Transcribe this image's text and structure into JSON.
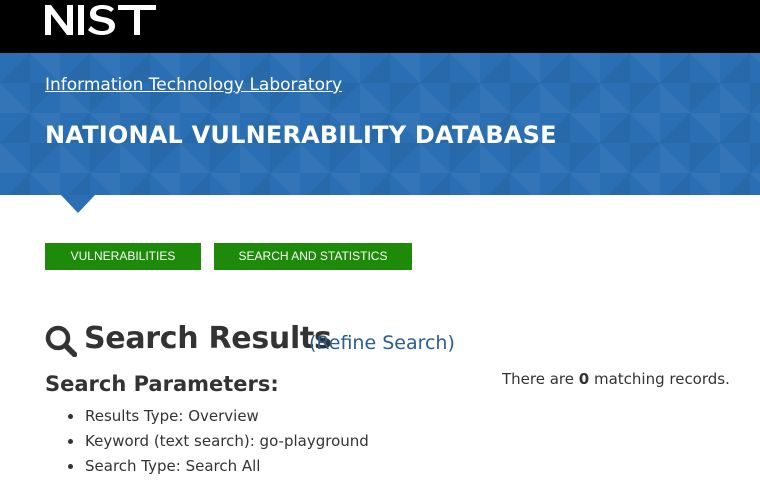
{
  "header": {
    "logo_text": "NIST",
    "lab_link": "Information Technology Laboratory",
    "site_title": "NATIONAL VULNERABILITY DATABASE"
  },
  "nav": {
    "buttons": [
      {
        "label": "VULNERABILITIES"
      },
      {
        "label": "SEARCH AND STATISTICS"
      }
    ]
  },
  "results": {
    "title": "Search Results",
    "refine_open": "(",
    "refine_label": "Refine Search",
    "refine_close": ")",
    "params_heading": "Search Parameters:",
    "params": [
      "Results Type: Overview",
      "Keyword (text search): go-playground",
      "Search Type: Search All"
    ],
    "count_prefix": "There are ",
    "count": "0",
    "count_suffix": " matching records."
  },
  "colors": {
    "top_bar": "#000000",
    "banner": "#2a6fb3",
    "nav_button": "#1d8a0a",
    "link": "#2a5d94",
    "text": "#333333"
  },
  "icons": {
    "logo": "nist-logo",
    "search": "search-icon"
  }
}
